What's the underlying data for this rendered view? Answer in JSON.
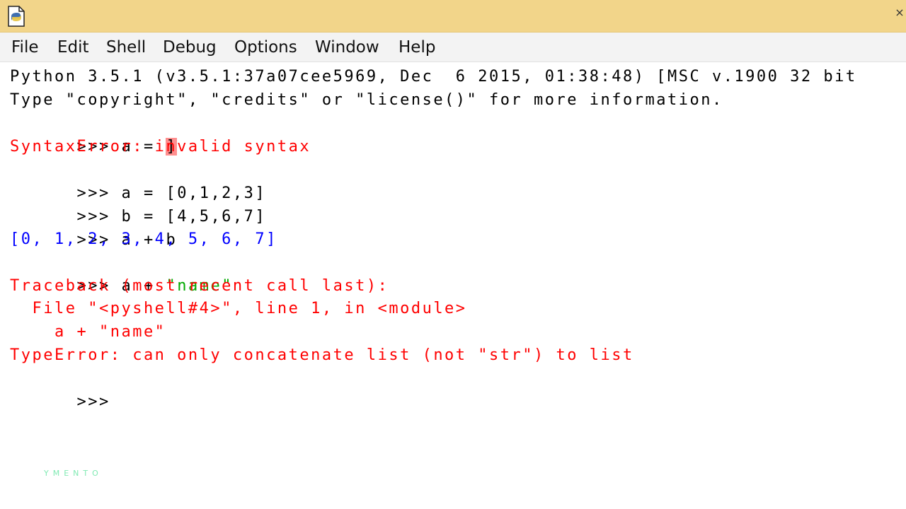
{
  "window": {
    "icon": "python-idle-file-icon",
    "close_label": "×"
  },
  "menu": {
    "items": [
      "File",
      "Edit",
      "Shell",
      "Debug",
      "Options",
      "Window",
      "Help"
    ]
  },
  "shell": {
    "banner_1": "Python 3.5.1 (v3.5.1:37a07cee5969, Dec  6 2015, 01:38:48) [MSC v.1900 32 bit",
    "banner_2": "Type \"copyright\", \"credits\" or \"license()\" for more information.",
    "prompt": ">>>",
    "line_1_code": " a = ",
    "line_1_cursor": "]",
    "line_2_error": "SyntaxError: invalid syntax",
    "line_3_code": " a = [0,1,2,3]",
    "line_4_code": " b = [4,5,6,7]",
    "line_5_code": " a + b",
    "line_6_output": "[0, 1, 2, 3, 4, 5, 6, 7]",
    "line_7_code": " a + ",
    "line_7_string": "\"name\"",
    "traceback_1": "Traceback (most recent call last):",
    "traceback_2": "  File \"<pyshell#4>\", line 1, in <module>",
    "traceback_3": "    a + \"name\"",
    "traceback_4": "TypeError: can only concatenate list (not \"str\") to list",
    "watermark": "YMENTO"
  },
  "colors": {
    "titlebar": "#f2d58a",
    "prompt_text": "#000000",
    "output": "#0000ff",
    "error": "#ff0000",
    "string": "#00aa00",
    "cursor_highlight": "#ff8f8f"
  }
}
